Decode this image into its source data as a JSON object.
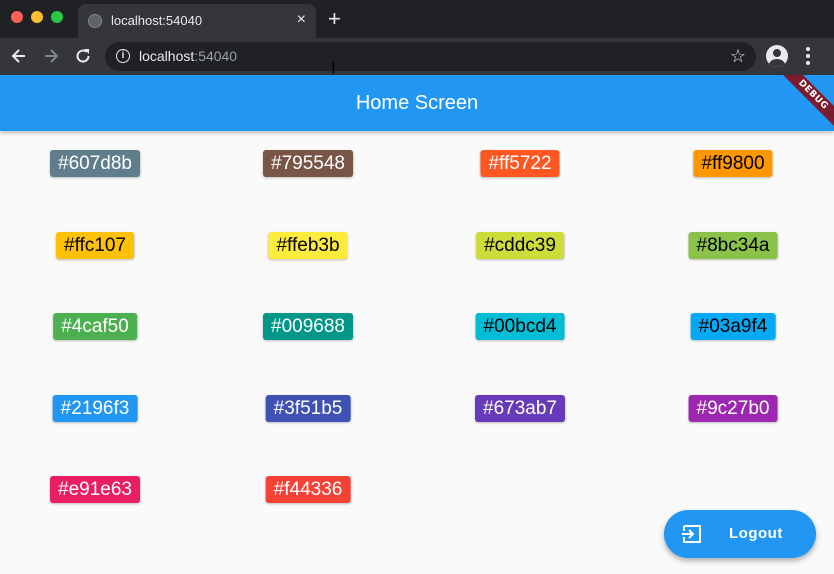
{
  "browser": {
    "tab_title": "localhost:54040",
    "tab_close": "×",
    "new_tab": "+",
    "url_host": "localhost",
    "url_port": ":54040",
    "star": "☆",
    "info": "i",
    "cursor": "I"
  },
  "app": {
    "title": "Home Screen",
    "debug_banner": "DEBUG",
    "logout_label": "Logout",
    "colors": [
      {
        "label": "#607d8b",
        "bg": "#607d8b",
        "fg": "#ffffff"
      },
      {
        "label": "#795548",
        "bg": "#795548",
        "fg": "#ffffff"
      },
      {
        "label": "#ff5722",
        "bg": "#ff5722",
        "fg": "#ffffff"
      },
      {
        "label": "#ff9800",
        "bg": "#ff9800",
        "fg": "#000000"
      },
      {
        "label": "#ffc107",
        "bg": "#ffc107",
        "fg": "#000000"
      },
      {
        "label": "#ffeb3b",
        "bg": "#ffeb3b",
        "fg": "#000000"
      },
      {
        "label": "#cddc39",
        "bg": "#cddc39",
        "fg": "#000000"
      },
      {
        "label": "#8bc34a",
        "bg": "#8bc34a",
        "fg": "#000000"
      },
      {
        "label": "#4caf50",
        "bg": "#4caf50",
        "fg": "#ffffff"
      },
      {
        "label": "#009688",
        "bg": "#009688",
        "fg": "#ffffff"
      },
      {
        "label": "#00bcd4",
        "bg": "#00bcd4",
        "fg": "#000000"
      },
      {
        "label": "#03a9f4",
        "bg": "#03a9f4",
        "fg": "#000000"
      },
      {
        "label": "#2196f3",
        "bg": "#2196f3",
        "fg": "#ffffff"
      },
      {
        "label": "#3f51b5",
        "bg": "#3f51b5",
        "fg": "#ffffff"
      },
      {
        "label": "#673ab7",
        "bg": "#673ab7",
        "fg": "#ffffff"
      },
      {
        "label": "#9c27b0",
        "bg": "#9c27b0",
        "fg": "#ffffff"
      },
      {
        "label": "#e91e63",
        "bg": "#e91e63",
        "fg": "#ffffff"
      },
      {
        "label": "#f44336",
        "bg": "#f44336",
        "fg": "#ffffff"
      }
    ]
  }
}
